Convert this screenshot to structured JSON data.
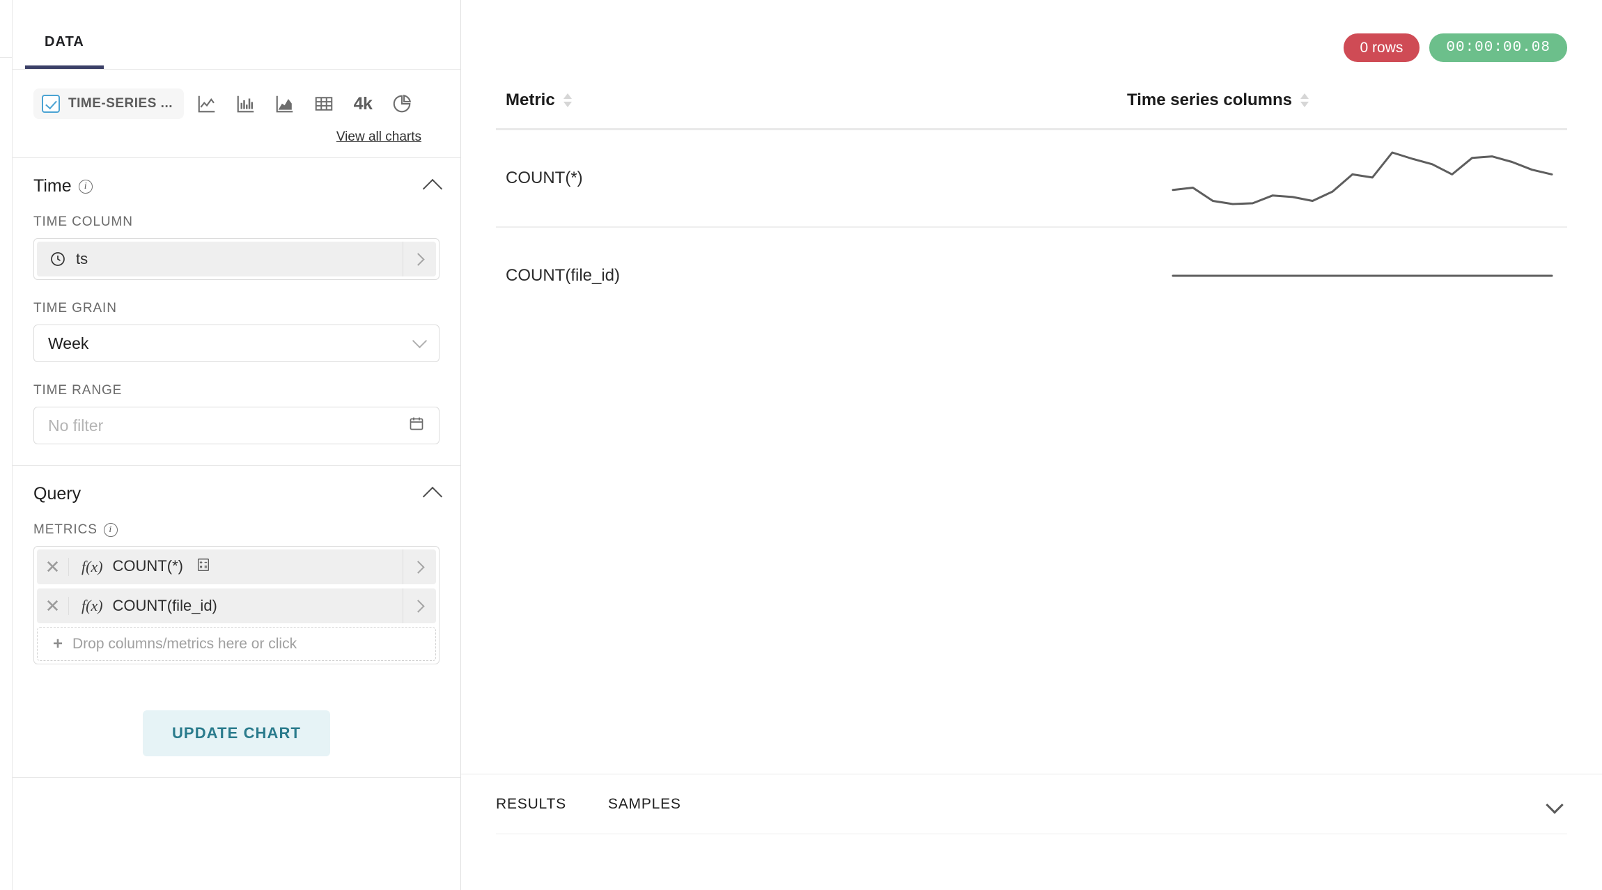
{
  "panel": {
    "tabs": [
      {
        "label": "DATA",
        "active": true
      }
    ],
    "viz": {
      "selected_label": "TIME-SERIES ...",
      "icons": [
        {
          "name": "line-chart-icon"
        },
        {
          "name": "bar-chart-icon"
        },
        {
          "name": "area-chart-icon"
        },
        {
          "name": "table-icon"
        },
        {
          "name": "big-number-icon",
          "label": "4k"
        },
        {
          "name": "pie-chart-icon"
        }
      ],
      "view_all_label": "View all charts"
    },
    "time_section": {
      "title": "Time",
      "time_column_label": "TIME COLUMN",
      "time_column_value": "ts",
      "time_grain_label": "TIME GRAIN",
      "time_grain_value": "Week",
      "time_range_label": "TIME RANGE",
      "time_range_placeholder": "No filter"
    },
    "query_section": {
      "title": "Query",
      "metrics_label": "METRICS",
      "metrics": [
        {
          "fx": "f(x)",
          "label": "COUNT(*)",
          "has_calc_icon": true
        },
        {
          "fx": "f(x)",
          "label": "COUNT(file_id)",
          "has_calc_icon": false
        }
      ],
      "dropzone_label": "Drop columns/metrics here or click"
    },
    "update_button_label": "UPDATE CHART"
  },
  "main": {
    "badges": {
      "rows": "0 rows",
      "timer": "00:00:00.08"
    },
    "results": {
      "tabs": [
        "RESULTS",
        "SAMPLES"
      ]
    }
  },
  "chart_data": {
    "type": "line",
    "title": "",
    "xlabel": "",
    "ylabel": "",
    "grid": false,
    "legend": "none",
    "columns": [
      "Metric",
      "Time series columns"
    ],
    "series": [
      {
        "name": "COUNT(*)",
        "values": [
          52,
          55,
          38,
          34,
          35,
          45,
          43,
          38,
          50,
          72,
          68,
          100,
          92,
          85,
          72,
          93,
          95,
          88,
          78,
          72
        ],
        "ylim": [
          30,
          100
        ]
      },
      {
        "name": "COUNT(file_id)",
        "values": [
          50,
          50,
          50,
          50,
          50,
          50,
          50,
          50,
          50,
          50,
          50,
          50,
          50,
          50,
          50,
          50,
          50,
          50,
          50,
          50
        ],
        "ylim": [
          0,
          100
        ]
      }
    ]
  },
  "colors": {
    "accent_tab": "#3b4067",
    "rows_badge": "#cf4b55",
    "timer_badge": "#6cbf8b",
    "button_text": "#2a7b8c",
    "button_bg": "#e6f3f6",
    "checkbox": "#4ba3d3",
    "sparkline": "#5e5e5e"
  }
}
